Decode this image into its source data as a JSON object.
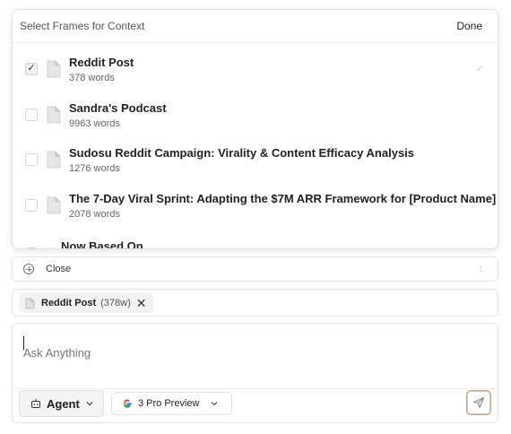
{
  "popover": {
    "title": "Select Frames for Context",
    "done_label": "Done",
    "frames": [
      {
        "name": "Reddit Post",
        "words": "378 words",
        "checked": true
      },
      {
        "name": "Sandra's Podcast",
        "words": "9963 words",
        "checked": false
      },
      {
        "name": "Sudosu Reddit Campaign: Virality & Content Efficacy Analysis",
        "words": "1276 words",
        "checked": false
      },
      {
        "name": "The 7-Day Viral Sprint: Adapting the $7M ARR Framework for [Product Name]",
        "words": "2078 words",
        "checked": false
      },
      {
        "name": "Now Based On",
        "words": "",
        "checked": false
      }
    ]
  },
  "close_row": {
    "label": "Close",
    "count": "1"
  },
  "context_chip": {
    "name": "Reddit Post",
    "count": "(378w)"
  },
  "composer": {
    "placeholder": "Ask Anything",
    "agent_label": "Agent",
    "model_label": "3 Pro Preview"
  },
  "icons": {
    "check": "checkmark-icon",
    "doc": "document-icon",
    "plus": "plus-circle-icon",
    "close": "close-x-icon",
    "robot": "robot-icon",
    "chevron": "chevron-down-icon",
    "google": "google-g-icon",
    "send": "send-icon"
  },
  "colors": {
    "send_border": "#e79a4f",
    "send_glow": "#78aae6"
  }
}
